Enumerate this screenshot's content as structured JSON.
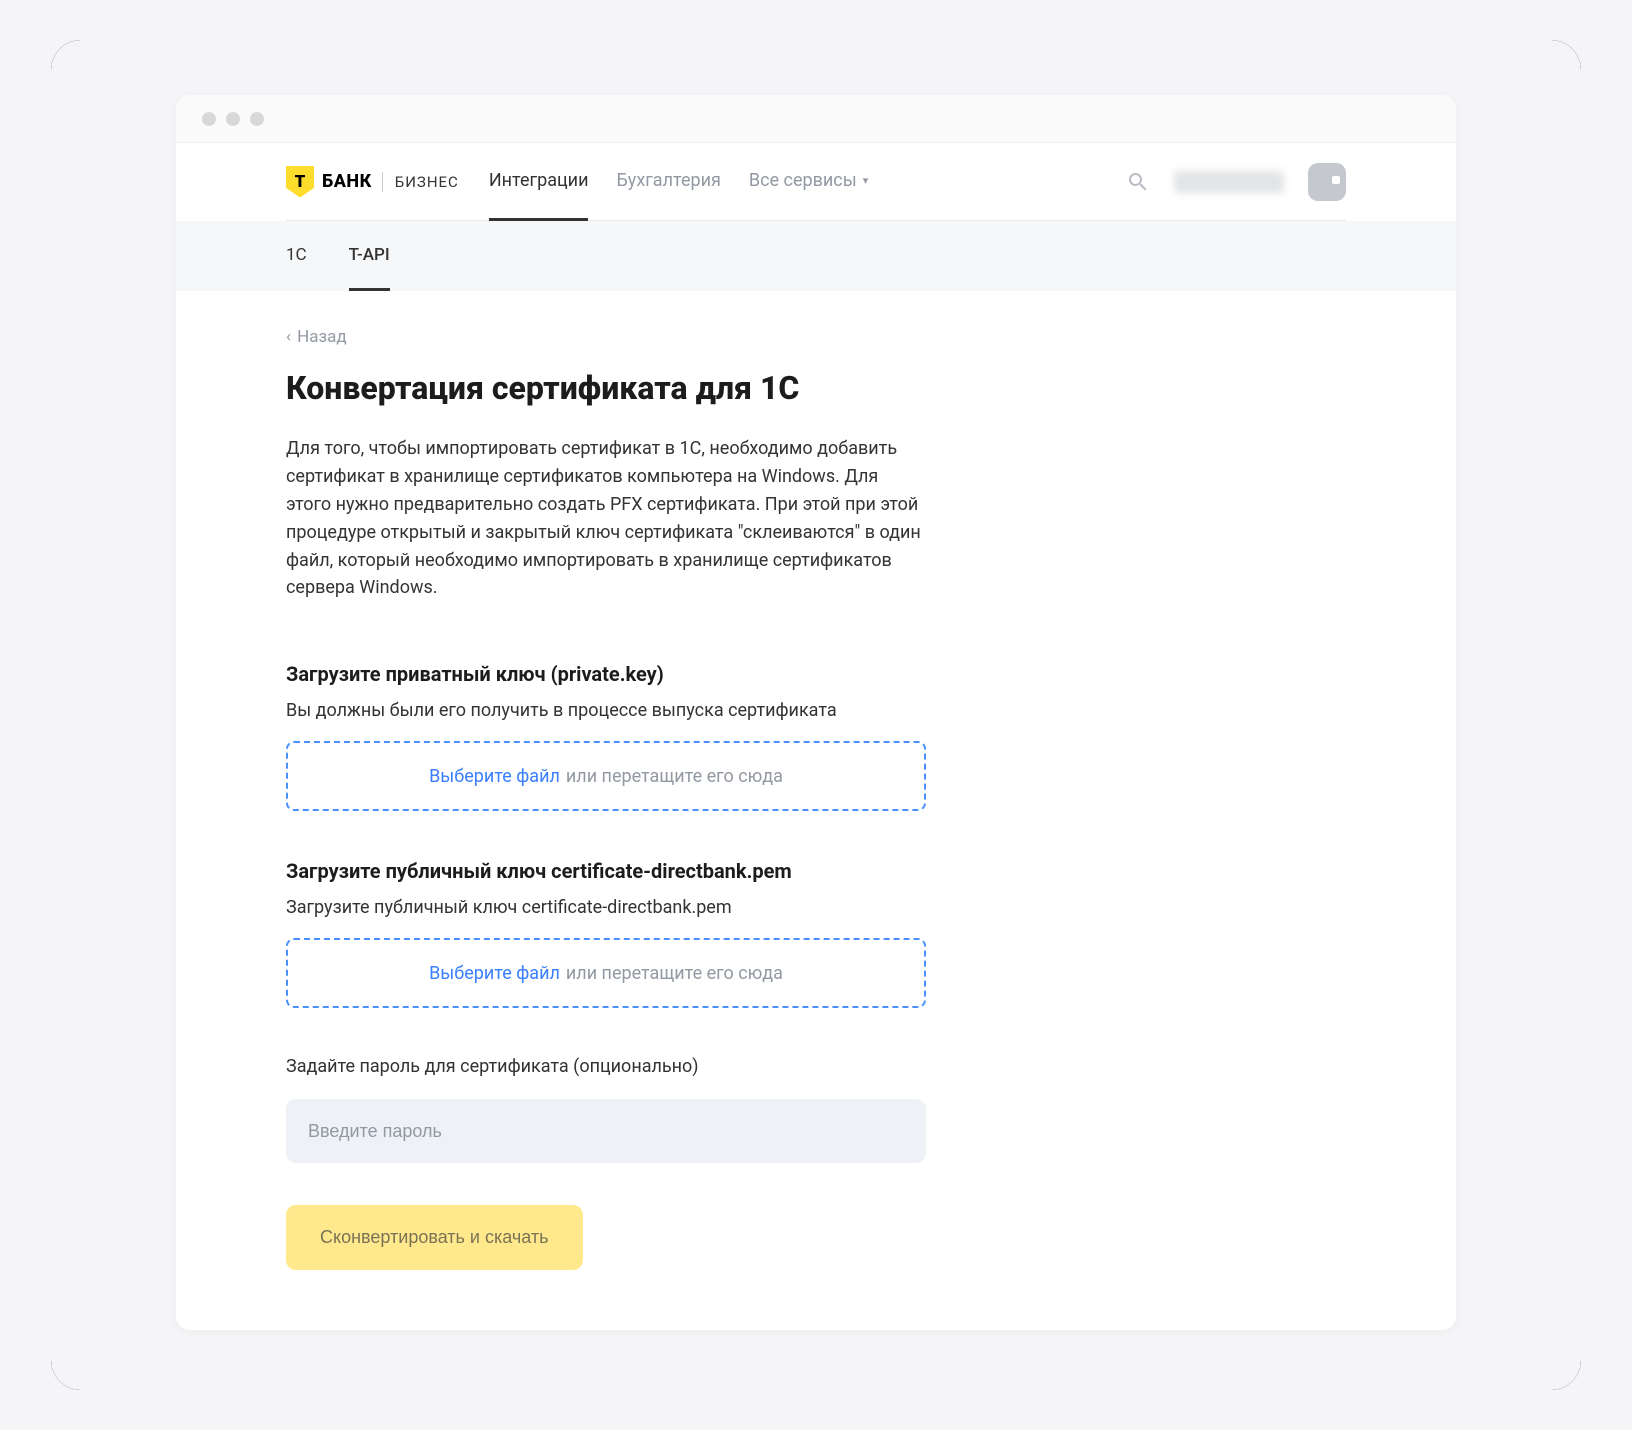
{
  "header": {
    "logo_letter": "Т",
    "logo_bank": "БАНК",
    "logo_sub": "БИЗНЕС",
    "nav": [
      {
        "label": "Интеграции",
        "active": true
      },
      {
        "label": "Бухгалтерия",
        "active": false
      },
      {
        "label": "Все сервисы",
        "active": false,
        "dropdown": true
      }
    ]
  },
  "subnav": [
    {
      "label": "1С",
      "active": false
    },
    {
      "label": "T-API",
      "active": true
    }
  ],
  "page": {
    "back_label": "Назад",
    "title": "Конвертация сертификата для 1С",
    "description": "Для того, чтобы импортировать сертификат в 1С, необходимо добавить сертификат в хранилище сертификатов компьютера на Windows. Для этого нужно предварительно создать PFX сертификата. При этой при этой процедуре открытый и закрытый ключ сертификата \"склеиваются\" в один файл, который необходимо импортировать в хранилище сертификатов сервера Windows.",
    "sections": {
      "private_key": {
        "heading": "Загрузите приватный ключ (private.key)",
        "hint": "Вы должны были его получить в процессе выпуска сертификата",
        "choose_file": "Выберите файл",
        "drop_rest": "или перетащите его сюда"
      },
      "public_key": {
        "heading": "Загрузите публичный ключ certificate-directbank.pem",
        "hint": "Загрузите публичный ключ certificate-directbank.pem",
        "choose_file": "Выберите файл",
        "drop_rest": "или перетащите его сюда"
      },
      "password": {
        "label": "Задайте пароль для сертификата (опционально)",
        "placeholder": "Введите пароль"
      }
    },
    "convert_button": "Сконвертировать и скачать"
  }
}
